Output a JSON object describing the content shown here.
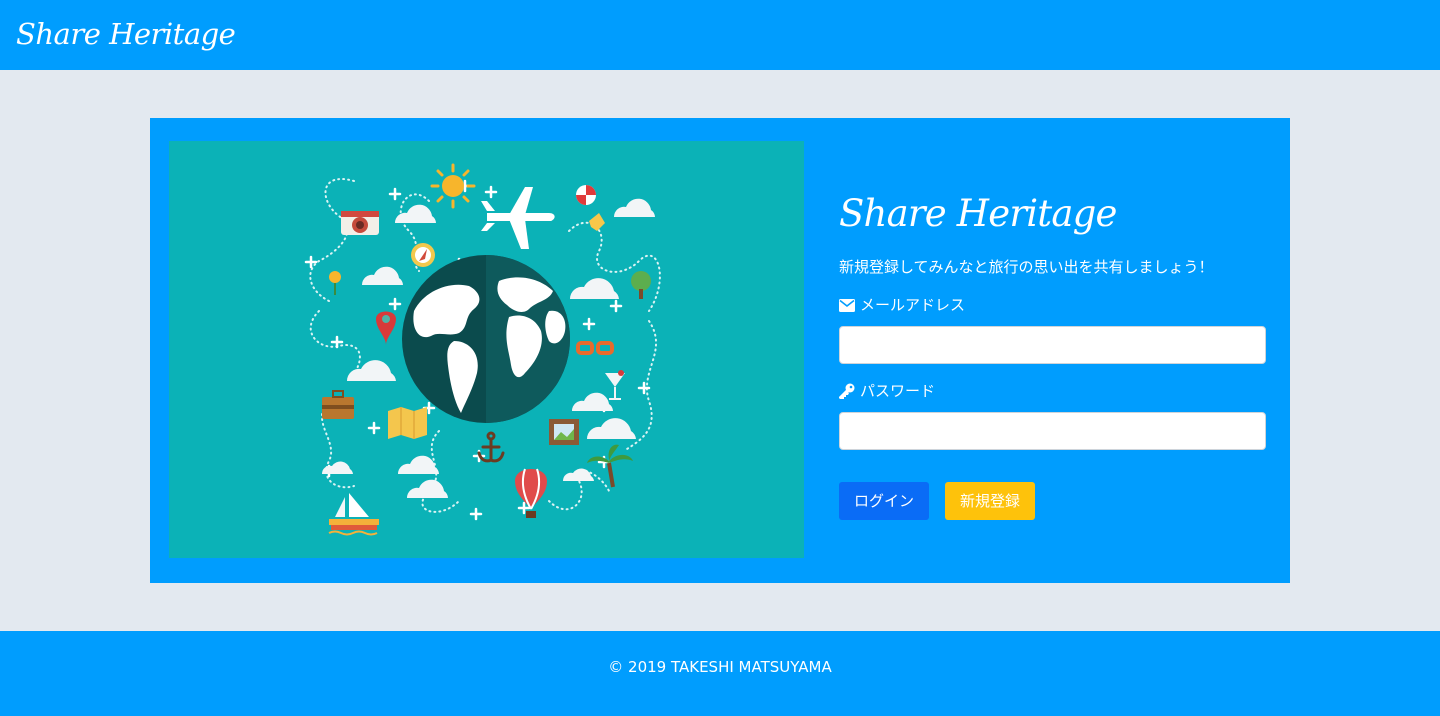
{
  "navbar": {
    "brand": "Share Heritage"
  },
  "hero": {
    "illustration": "travel-globe-illustration"
  },
  "form": {
    "title": "Share Heritage",
    "lead": "新規登録してみんなと旅行の思い出を共有しましょう！",
    "email": {
      "icon": "envelope-icon",
      "label": "メールアドレス",
      "value": "",
      "placeholder": ""
    },
    "password": {
      "icon": "key-icon",
      "label": "パスワード",
      "value": "",
      "placeholder": ""
    },
    "login_button": "ログイン",
    "signup_button": "新規登録"
  },
  "footer": {
    "copyright": "© 2019 TAKESHI MATSUYAMA"
  },
  "colors": {
    "primary": "#009dfe",
    "background": "#e3e9f0",
    "hero_bg": "#0bb2b7",
    "login_button": "#0a6cf6",
    "signup_button": "#fec20b"
  }
}
